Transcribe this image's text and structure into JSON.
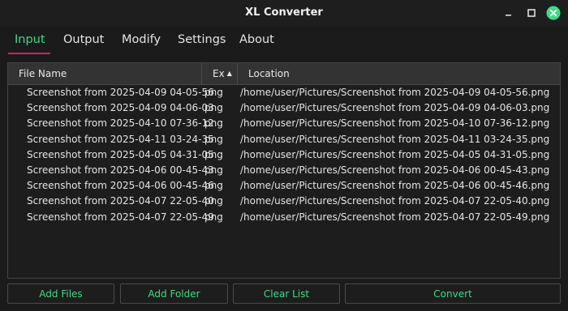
{
  "window": {
    "title": "XL Converter",
    "close_color": "#3ddc84"
  },
  "tabs": [
    {
      "label": "Input",
      "active": true
    },
    {
      "label": "Output",
      "active": false
    },
    {
      "label": "Modify",
      "active": false
    },
    {
      "label": "Settings",
      "active": false
    },
    {
      "label": "About",
      "active": false
    }
  ],
  "table": {
    "columns": {
      "name": "File Name",
      "ext": "Ex",
      "location": "Location"
    },
    "sort": {
      "column": "ext",
      "direction": "ascending"
    },
    "rows": [
      {
        "name": "Screenshot from 2025-04-09 04-05-56",
        "ext": "png",
        "location": "/home/user/Pictures/Screenshot from 2025-04-09 04-05-56.png"
      },
      {
        "name": "Screenshot from 2025-04-09 04-06-03",
        "ext": "png",
        "location": "/home/user/Pictures/Screenshot from 2025-04-09 04-06-03.png"
      },
      {
        "name": "Screenshot from 2025-04-10 07-36-12",
        "ext": "png",
        "location": "/home/user/Pictures/Screenshot from 2025-04-10 07-36-12.png"
      },
      {
        "name": "Screenshot from 2025-04-11 03-24-35",
        "ext": "png",
        "location": "/home/user/Pictures/Screenshot from 2025-04-11 03-24-35.png"
      },
      {
        "name": "Screenshot from 2025-04-05 04-31-05",
        "ext": "png",
        "location": "/home/user/Pictures/Screenshot from 2025-04-05 04-31-05.png"
      },
      {
        "name": "Screenshot from 2025-04-06 00-45-43",
        "ext": "png",
        "location": "/home/user/Pictures/Screenshot from 2025-04-06 00-45-43.png"
      },
      {
        "name": "Screenshot from 2025-04-06 00-45-46",
        "ext": "png",
        "location": "/home/user/Pictures/Screenshot from 2025-04-06 00-45-46.png"
      },
      {
        "name": "Screenshot from 2025-04-07 22-05-40",
        "ext": "png",
        "location": "/home/user/Pictures/Screenshot from 2025-04-07 22-05-40.png"
      },
      {
        "name": "Screenshot from 2025-04-07 22-05-49",
        "ext": "png",
        "location": "/home/user/Pictures/Screenshot from 2025-04-07 22-05-49.png"
      }
    ]
  },
  "buttons": {
    "add_files": "Add Files",
    "add_folder": "Add Folder",
    "clear_list": "Clear List",
    "convert": "Convert"
  },
  "colors": {
    "accent": "#3ddc84",
    "tab_underline": "#e0186e",
    "background": "#1b1b1b"
  },
  "icons": {
    "minimize": "minimize-icon",
    "maximize": "maximize-icon",
    "close": "close-icon",
    "sort": "sort-ascending-icon"
  }
}
